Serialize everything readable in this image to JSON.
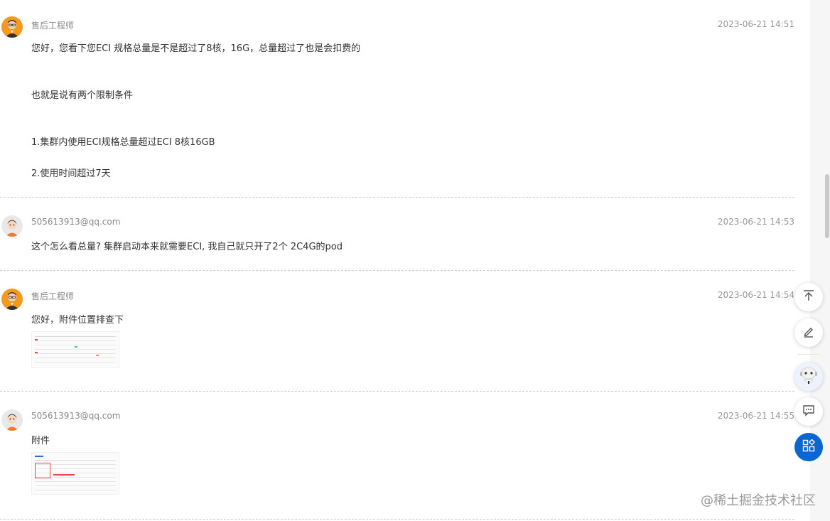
{
  "messages": [
    {
      "sender": "售后工程师",
      "role": "engineer",
      "time": "2023-06-21 14:51",
      "lines": [
        "您好，您看下您ECI 规格总量是不是超过了8核，16G，总量超过了也是会扣费的",
        "也就是说有两个限制条件",
        "1.集群内使用ECI规格总量超过ECI 8核16GB",
        "2.使用时间超过7天"
      ]
    },
    {
      "sender": "505613913@qq.com",
      "role": "user",
      "time": "2023-06-21 14:53",
      "lines": [
        "这个怎么看总量? 集群启动本来就需要ECI, 我自己就只开了2个 2C4G的pod"
      ]
    },
    {
      "sender": "售后工程师",
      "role": "engineer",
      "time": "2023-06-21 14:54",
      "lines": [
        "您好，附件位置排查下"
      ],
      "has_attachment": true
    },
    {
      "sender": "505613913@qq.com",
      "role": "user",
      "time": "2023-06-21 14:55",
      "lines": [
        "附件"
      ],
      "has_attachment": true
    }
  ],
  "floating_actions": [
    {
      "icon": "back-to-top-icon"
    },
    {
      "icon": "edit-icon"
    },
    {
      "icon": "assistant-robot-icon"
    },
    {
      "icon": "chat-message-icon"
    },
    {
      "icon": "apps-grid-icon"
    }
  ],
  "watermark": "@稀土掘金技术社区",
  "colors": {
    "primary": "#0a66d1",
    "engineer_avatar": "#f39a1e"
  }
}
